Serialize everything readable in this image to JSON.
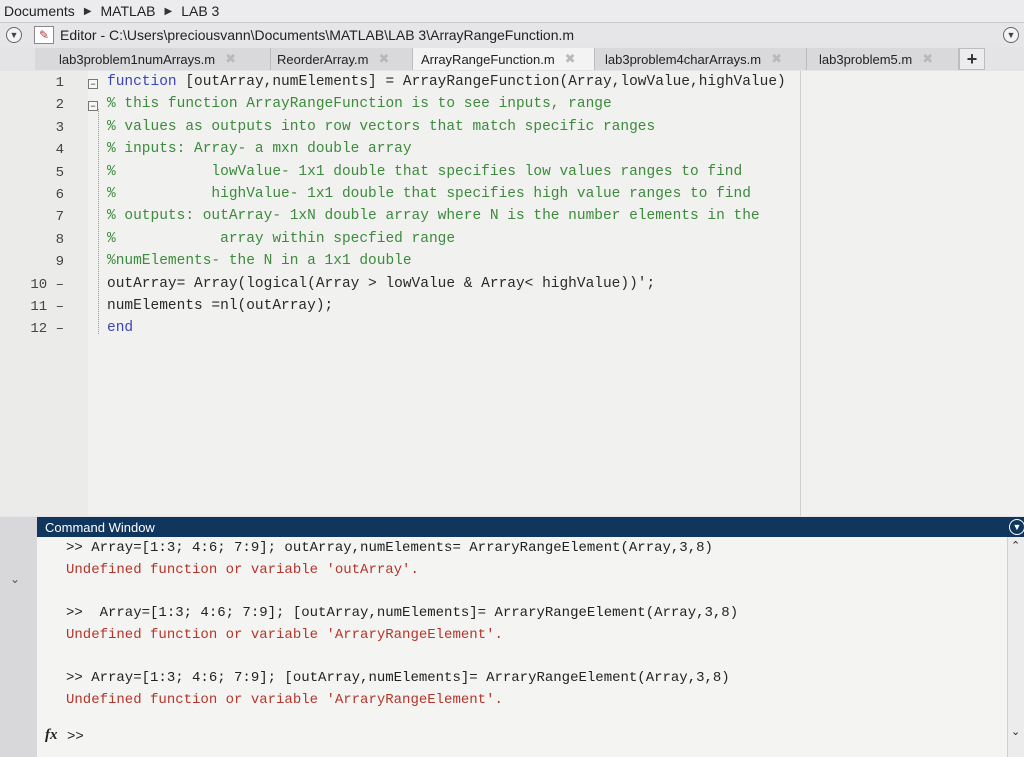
{
  "breadcrumb": [
    "Documents",
    "MATLAB",
    "LAB 3"
  ],
  "editor": {
    "title": "Editor - C:\\Users\\preciousvann\\Documents\\MATLAB\\LAB 3\\ArrayRangeFunction.m",
    "tabs": [
      {
        "label": "lab3problem1numArrays.m"
      },
      {
        "label": "ReorderArray.m"
      },
      {
        "label": "ArrayRangeFunction.m"
      },
      {
        "label": "lab3problem4charArrays.m"
      },
      {
        "label": "lab3problem5.m"
      }
    ],
    "active_tab": 2,
    "line_numbers": [
      "1",
      "2",
      "3",
      "4",
      "5",
      "6",
      "7",
      "8",
      "9",
      "10",
      "11",
      "12"
    ],
    "lines": [
      {
        "parts": [
          {
            "t": "function",
            "c": "kw"
          },
          {
            "t": " [outArray,numElements] = ArrayRangeFunction(Array,lowValue,highValue)",
            "c": ""
          }
        ]
      },
      {
        "parts": [
          {
            "t": "% this function ArrayRangeFunction is to see inputs, range",
            "c": "cm"
          }
        ]
      },
      {
        "parts": [
          {
            "t": "% values as outputs into row vectors that match specific ranges",
            "c": "cm"
          }
        ]
      },
      {
        "parts": [
          {
            "t": "% inputs: Array- a mxn double array",
            "c": "cm"
          }
        ]
      },
      {
        "parts": [
          {
            "t": "%           lowValue- 1x1 double that specifies low values ranges to find",
            "c": "cm"
          }
        ]
      },
      {
        "parts": [
          {
            "t": "%           highValue- 1x1 double that specifies high value ranges to find",
            "c": "cm"
          }
        ]
      },
      {
        "parts": [
          {
            "t": "% outputs: outArray- 1xN double array where N is the number elements in the",
            "c": "cm"
          }
        ]
      },
      {
        "parts": [
          {
            "t": "%            array within specfied range",
            "c": "cm"
          }
        ]
      },
      {
        "parts": [
          {
            "t": "%numElements- the N in a 1x1 double",
            "c": "cm"
          }
        ]
      },
      {
        "parts": [
          {
            "t": "outArray= Array(logical(Array > lowValue & Array< highValue))';",
            "c": ""
          }
        ]
      },
      {
        "parts": [
          {
            "t": "numElements =nl(outArray);",
            "c": ""
          }
        ]
      },
      {
        "parts": [
          {
            "t": "end",
            "c": "kw"
          }
        ]
      }
    ]
  },
  "command_window": {
    "title": "Command Window",
    "entries": [
      {
        "cmd": ">> Array=[1:3; 4:6; 7:9]; outArray,numElements= ArraryRangeElement(Array,3,8)",
        "err": "Undefined function or variable 'outArray'."
      },
      {
        "cmd": ">>  Array=[1:3; 4:6; 7:9]; [outArray,numElements]= ArraryRangeElement(Array,3,8)",
        "err": "Undefined function or variable 'ArraryRangeElement'."
      },
      {
        "cmd": ">> Array=[1:3; 4:6; 7:9]; [outArray,numElements]= ArraryRangeElement(Array,3,8)",
        "err": "Undefined function or variable 'ArraryRangeElement'."
      }
    ],
    "prompt": ">>",
    "fx_label": "fx"
  },
  "icons": {
    "close_tab": "close-icon",
    "add_tab": "plus-icon",
    "collapse": "chevron-down-icon"
  }
}
